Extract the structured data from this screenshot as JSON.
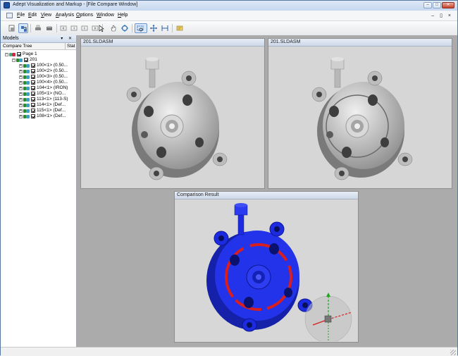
{
  "window": {
    "title": "Adept Visualization and Markup - [File Compare Window]",
    "controls": {
      "minimize": "–",
      "maximize": "□",
      "close": "✕"
    },
    "mdi_controls": "– ▯ ×"
  },
  "menu": {
    "items": [
      "File",
      "Edit",
      "View",
      "Analysis",
      "Options",
      "Window",
      "Help"
    ]
  },
  "toolbar": {
    "icons": [
      "new-doc-icon",
      "open-icon",
      "print-icon",
      "scan-icon",
      "first-page-icon",
      "prev-page-icon",
      "next-page-icon",
      "last-page-icon",
      "select-arrow-icon",
      "pan-hand-icon",
      "rotate-icon",
      "zoom-window-icon",
      "fit-all-icon",
      "fit-width-icon",
      "markup-icon"
    ]
  },
  "models_pane": {
    "title": "Models",
    "controls": "▾ ✕",
    "columns": [
      "Compare Tree",
      "Stat"
    ],
    "tree": [
      {
        "label": "Page 1",
        "level": 0,
        "exp": "−",
        "kind": "page"
      },
      {
        "label": "201",
        "level": 1,
        "exp": "−",
        "kind": "asm"
      },
      {
        "label": "100<1> (0.50...",
        "level": 2,
        "exp": "+",
        "kind": "part"
      },
      {
        "label": "100<2> (0.50...",
        "level": 2,
        "exp": "+",
        "kind": "part"
      },
      {
        "label": "100<3> (0.50...",
        "level": 2,
        "exp": "+",
        "kind": "part"
      },
      {
        "label": "100<4> (0.50...",
        "level": 2,
        "exp": "+",
        "kind": "part"
      },
      {
        "label": "104<1> (IRON)",
        "level": 2,
        "exp": "+",
        "kind": "part"
      },
      {
        "label": "105<1> (NO...",
        "level": 2,
        "exp": "+",
        "kind": "part"
      },
      {
        "label": "113<1> (113-S)",
        "level": 2,
        "exp": "+",
        "kind": "part"
      },
      {
        "label": "114<1> (Def...",
        "level": 2,
        "exp": "+",
        "kind": "part"
      },
      {
        "label": "115<1> (Def...",
        "level": 2,
        "exp": "+",
        "kind": "part"
      },
      {
        "label": "108<1> (Def...",
        "level": 2,
        "exp": "+",
        "kind": "part"
      }
    ]
  },
  "views": {
    "left": {
      "title": "201.SLDASM"
    },
    "right": {
      "title": "201.SLDASM"
    },
    "result": {
      "title": "Comparison Result"
    }
  },
  "colors": {
    "diff_blue": "#1f2ee6",
    "diff_red": "#d81e1e",
    "model_gray": "#c4c4c4",
    "triad_green": "#1ca61c"
  }
}
